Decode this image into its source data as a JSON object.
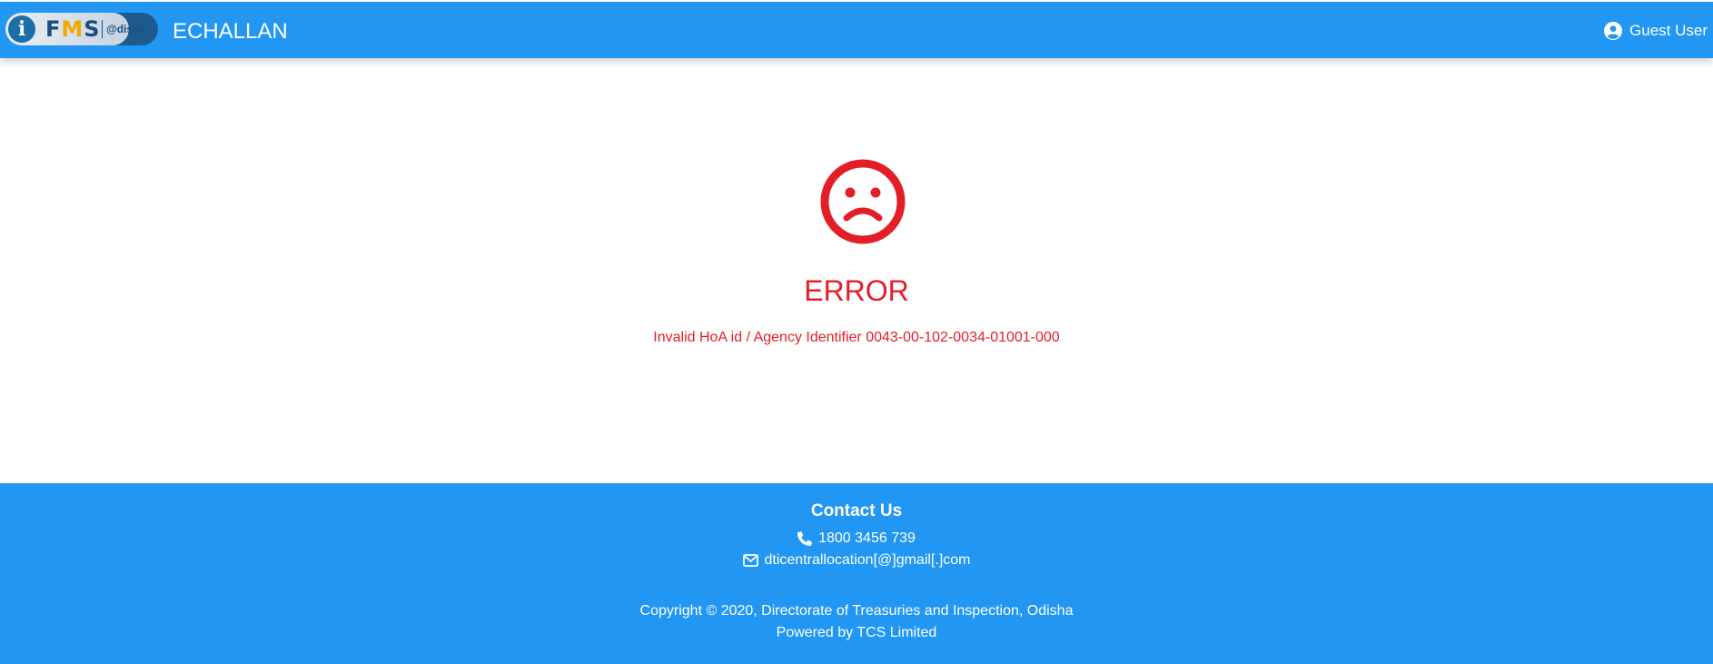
{
  "header": {
    "logo": {
      "mark": "i",
      "name_prefix": "F",
      "name_accent": "M",
      "name_suffix": "S",
      "region": "@disha"
    },
    "title": "ECHALLAN",
    "user_label": "Guest User",
    "user_icon": "user-circle-icon",
    "bar_color": "#2196f3"
  },
  "error": {
    "icon": "sad-face-icon",
    "title": "ERROR",
    "message": "Invalid HoA id / Agency Identifier 0043-00-102-0034-01001-000",
    "color": "#e41e26"
  },
  "footer": {
    "contact_title": "Contact Us",
    "phone_icon": "phone-icon",
    "phone": "1800 3456 739",
    "email_icon": "envelope-icon",
    "email": "dticentrallocation[@]gmail[.]com",
    "copyright": "Copyright © 2020, Directorate of Treasuries and Inspection, Odisha",
    "powered_by": "Powered by TCS Limited"
  }
}
